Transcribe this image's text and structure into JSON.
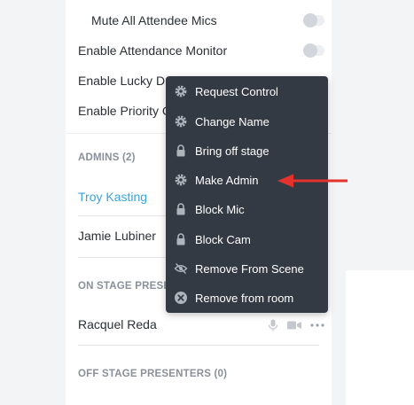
{
  "settings": {
    "toggles": [
      {
        "label": "Mute All Attendee Mics",
        "on": false
      },
      {
        "label": "Enable Attendance Monitor",
        "on": false
      },
      {
        "label": "Enable Lucky Dr",
        "on": false
      },
      {
        "label": "Enable Priority C",
        "on": false
      }
    ]
  },
  "admins": {
    "header": "ADMINS (2)",
    "people": [
      "Troy Kasting",
      "Jamie Lubiner"
    ]
  },
  "on_stage": {
    "header": "ON STAGE PRESENTER",
    "people": [
      "Racquel Reda"
    ]
  },
  "off_stage": {
    "header": "OFF STAGE PRESENTERS (0)"
  },
  "context_menu": {
    "items": [
      {
        "label": "Request Control",
        "icon": "gear-icon"
      },
      {
        "label": "Change Name",
        "icon": "gear-icon"
      },
      {
        "label": "Bring off stage",
        "icon": "lock-icon"
      },
      {
        "label": "Make Admin",
        "icon": "gear-icon"
      },
      {
        "label": "Block Mic",
        "icon": "lock-icon"
      },
      {
        "label": "Block Cam",
        "icon": "lock-icon"
      },
      {
        "label": "Remove From Scene",
        "icon": "eye-slash-icon"
      },
      {
        "label": "Remove from room",
        "icon": "close-circle-icon"
      }
    ]
  },
  "colors": {
    "menu_bg": "#343a43",
    "link": "#3aa3df",
    "annotation_arrow": "#e5322d"
  }
}
